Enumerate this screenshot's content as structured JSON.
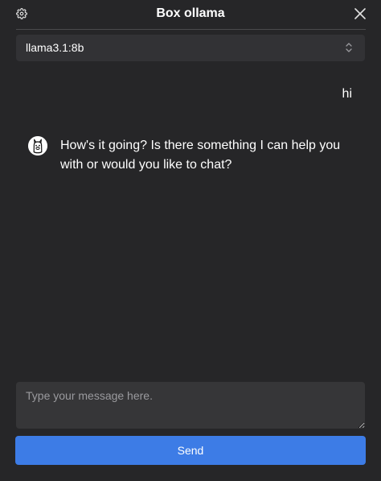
{
  "header": {
    "title": "Box ollama",
    "settings_icon": "gear-icon",
    "close_icon": "close-icon"
  },
  "model_select": {
    "value": "llama3.1:8b",
    "icon": "chevron-up-down-icon"
  },
  "messages": [
    {
      "role": "user",
      "text": "hi"
    },
    {
      "role": "assistant",
      "text": "How's it going? Is there something I can help you with or would you like to chat?",
      "avatar": "ollama-llama-icon"
    }
  ],
  "composer": {
    "placeholder": "Type your message here.",
    "value": ""
  },
  "send_button": {
    "label": "Send"
  },
  "colors": {
    "background": "#262628",
    "surface": "#323235",
    "accent": "#3d7ce6"
  }
}
